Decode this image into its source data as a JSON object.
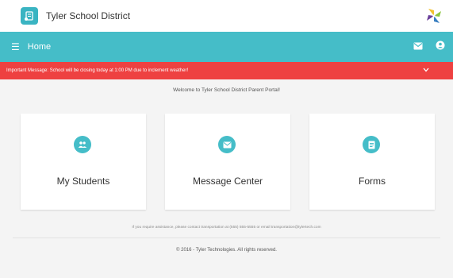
{
  "header": {
    "brand": "Tyler School District",
    "logo_icon": "document-leaf-icon",
    "corner_logo_icon": "tyler-pinwheel-logo"
  },
  "navbar": {
    "title": "Home",
    "menu_icon": "hamburger-icon",
    "mail_icon": "mail-icon",
    "user_icon": "user-icon"
  },
  "alert": {
    "message": "Important Message: School will be closing today at 1:00 PM due to inclement weather!",
    "chevron_icon": "chevron-down-icon"
  },
  "welcome": "Welcome to Tyler School District Parent Portal!",
  "cards": [
    {
      "label": "My Students",
      "icon": "people-icon"
    },
    {
      "label": "Message Center",
      "icon": "envelope-icon"
    },
    {
      "label": "Forms",
      "icon": "form-icon"
    }
  ],
  "footer": {
    "help": "If you require assistance, please contact transportation at (555) 555-5555 or email transportation@tylertech.com",
    "copyright": "© 2016 - Tyler Technologies. All rights reserved."
  },
  "colors": {
    "accent": "#45bdc8",
    "alert": "#ee4141",
    "background": "#f4f4f4"
  }
}
